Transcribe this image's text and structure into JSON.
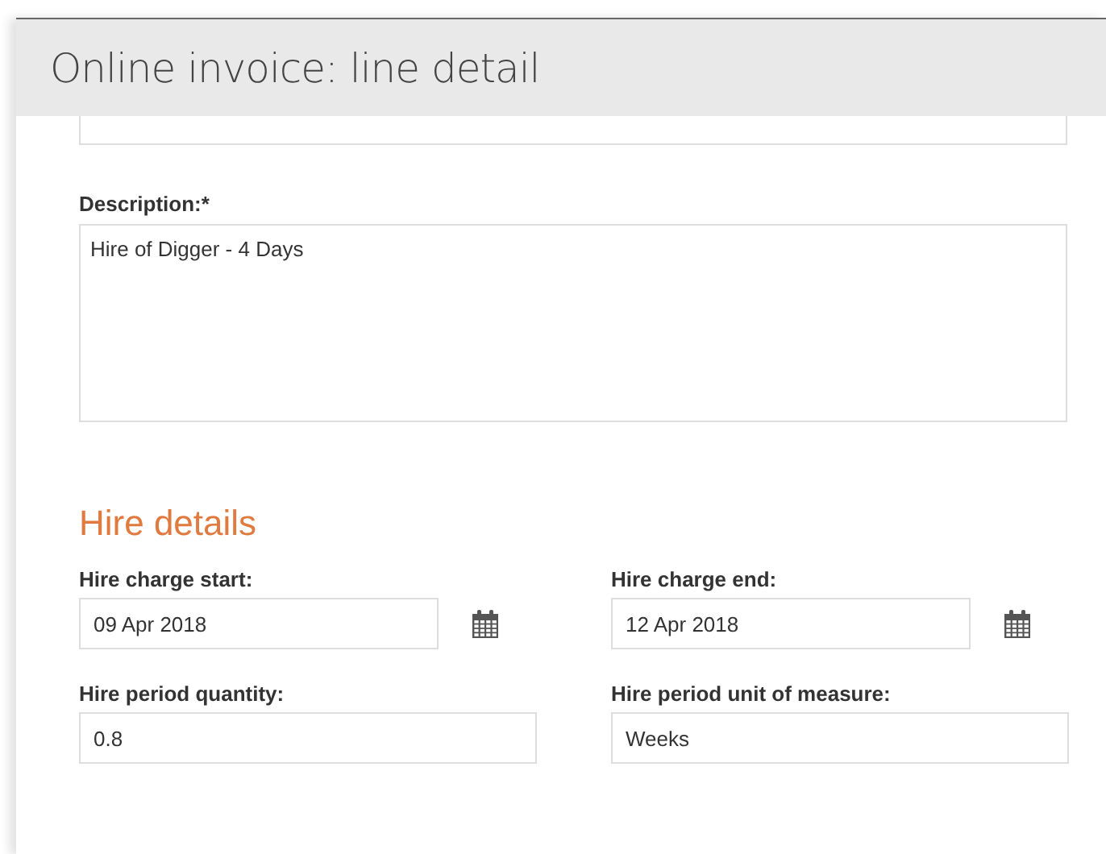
{
  "window": {
    "title": "Online invoice: line detail"
  },
  "description": {
    "label": "Description:*",
    "value": "Hire of Digger - 4 Days"
  },
  "hire_details": {
    "heading": "Hire details",
    "fields": [
      {
        "kind": "date",
        "label": "Hire charge start:",
        "value": "09 Apr 2018"
      },
      {
        "kind": "date",
        "label": "Hire charge end:",
        "value": "12 Apr 2018"
      },
      {
        "kind": "text",
        "label": "Hire period quantity:",
        "value": "0.8"
      },
      {
        "kind": "text",
        "label": "Hire period unit of measure:",
        "value": "Weeks"
      }
    ]
  }
}
